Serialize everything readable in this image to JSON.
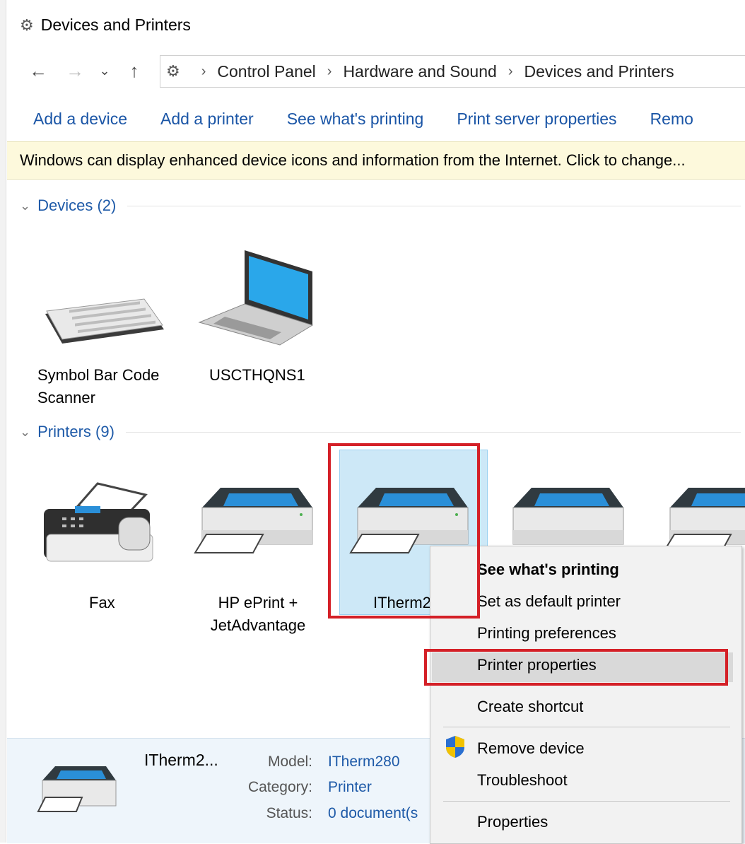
{
  "window": {
    "title": "Devices and Printers"
  },
  "address_bar": {
    "crumbs": [
      "Control Panel",
      "Hardware and Sound",
      "Devices and Printers"
    ]
  },
  "toolbar": {
    "items": [
      "Add a device",
      "Add a printer",
      "See what's printing",
      "Print server properties",
      "Remo"
    ]
  },
  "infobar": {
    "text": "Windows can display enhanced device icons and information from the Internet. Click to change..."
  },
  "groups": {
    "devices": {
      "label": "Devices (2)",
      "items": [
        {
          "label_line1": "Symbol Bar Code",
          "label_line2": "Scanner"
        },
        {
          "label_line1": "USCTHQNS1"
        }
      ]
    },
    "printers": {
      "label": "Printers (9)",
      "items": [
        {
          "label_line1": "Fax"
        },
        {
          "label_line1": "HP ePrint +",
          "label_line2": "JetAdvantage"
        },
        {
          "label_line1": "ITherm2"
        }
      ]
    }
  },
  "context_menu": {
    "items": [
      "See what's printing",
      "Set as default printer",
      "Printing preferences",
      "Printer properties",
      "Create shortcut",
      "Remove device",
      "Troubleshoot",
      "Properties"
    ],
    "highlighted": "Printer properties"
  },
  "details": {
    "name": "ITherm2...",
    "model_label": "Model:",
    "model_value": "ITherm280",
    "category_label": "Category:",
    "category_value": "Printer",
    "status_label": "Status:",
    "status_value": "0 document(s"
  },
  "colors": {
    "accent": "#1e5aa8",
    "highlight_box": "#d42027",
    "selection": "#cde8f7",
    "infobar": "#fdf9dc"
  }
}
